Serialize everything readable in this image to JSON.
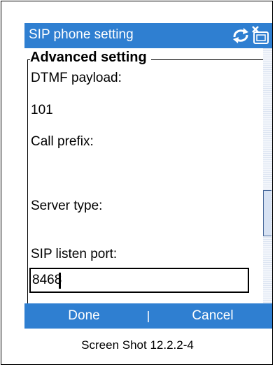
{
  "window": {
    "title": "SIP phone setting"
  },
  "status_icons": [
    "sync-icon",
    "phone-off-icon"
  ],
  "group": {
    "legend": "Advanced setting"
  },
  "fields": {
    "dtmf_label": "DTMF payload:",
    "dtmf_value": "101",
    "call_prefix_label": "Call prefix:",
    "server_type_label": "Server type:",
    "sip_port_label": "SIP listen port:",
    "sip_port_value": "8468"
  },
  "softkeys": {
    "left": "Done",
    "right": "Cancel"
  },
  "colors": {
    "bar": "#2f7fd1",
    "scroll": "#e8eef7"
  },
  "caption": "Screen Shot 12.2.2-4"
}
